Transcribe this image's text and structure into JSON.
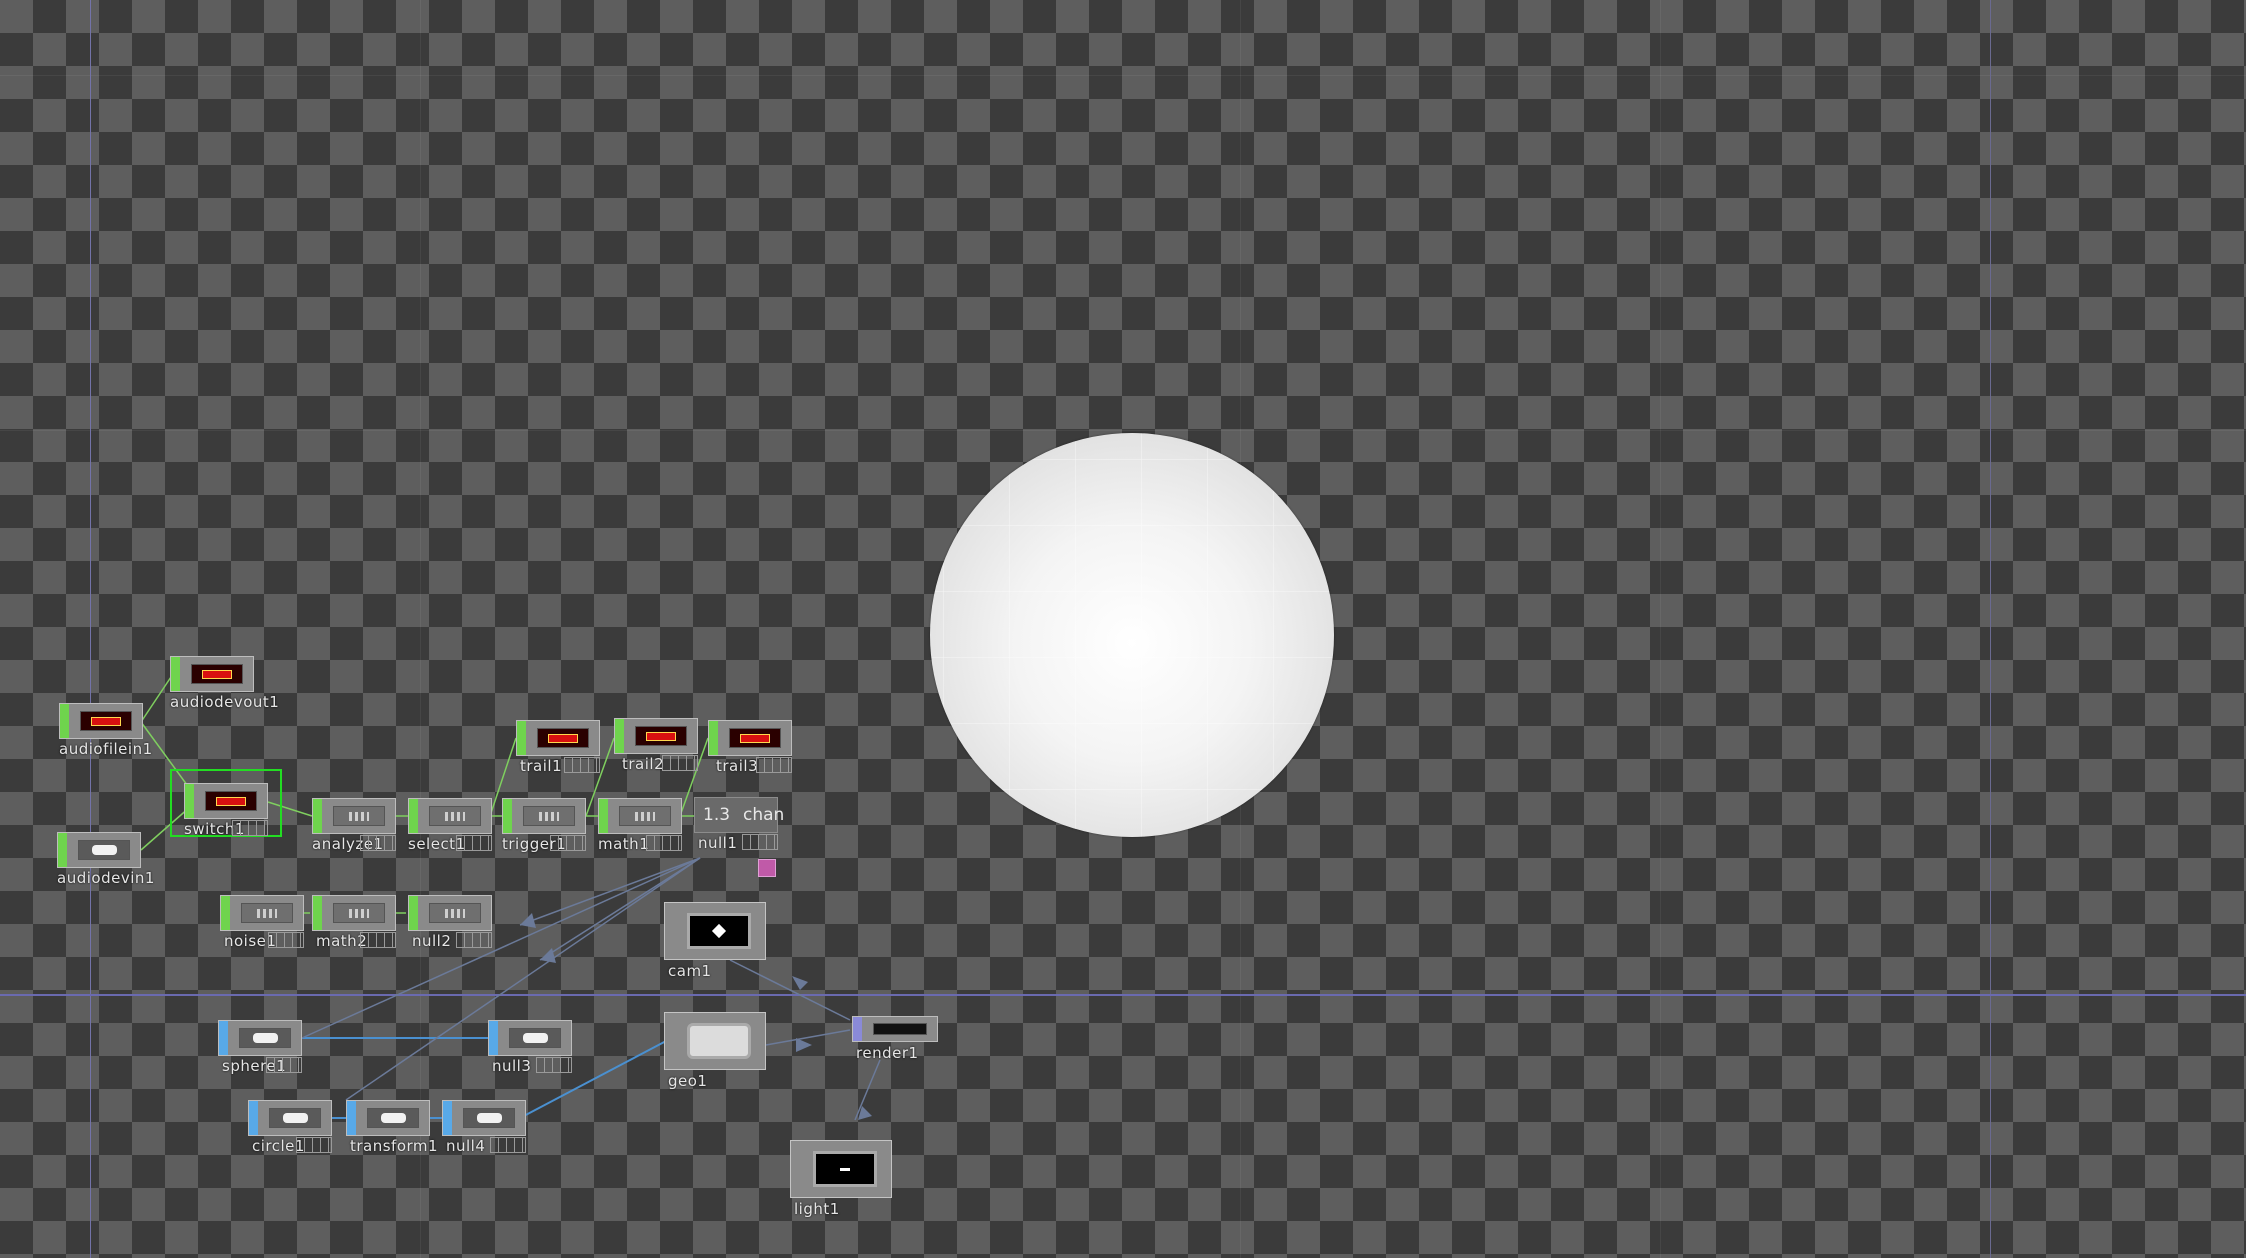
{
  "network": {
    "chop_nodes": [
      {
        "id": "audiodevout1",
        "label": "audiodevout1",
        "thumb": "red"
      },
      {
        "id": "audiofilein1",
        "label": "audiofilein1",
        "thumb": "red"
      },
      {
        "id": "switch1",
        "label": "switch1",
        "thumb": "red",
        "selected": true
      },
      {
        "id": "audiodevin1",
        "label": "audiodevin1",
        "thumb": "white"
      },
      {
        "id": "analyze1",
        "label": "analyze1",
        "thumb": "bars"
      },
      {
        "id": "select1",
        "label": "select1",
        "thumb": "bars"
      },
      {
        "id": "trigger1",
        "label": "trigger1",
        "thumb": "bars"
      },
      {
        "id": "math1",
        "label": "math1",
        "thumb": "bars"
      },
      {
        "id": "trail1",
        "label": "trail1",
        "thumb": "red"
      },
      {
        "id": "trail2",
        "label": "trail2",
        "thumb": "red"
      },
      {
        "id": "trail3",
        "label": "trail3",
        "thumb": "red"
      },
      {
        "id": "noise1",
        "label": "noise1",
        "thumb": "bars"
      },
      {
        "id": "math2",
        "label": "math2",
        "thumb": "bars"
      },
      {
        "id": "null2",
        "label": "null2",
        "thumb": "bars"
      }
    ],
    "null1": {
      "label": "null1",
      "value": "1.3",
      "channel": "chan"
    },
    "sop_nodes": [
      {
        "id": "sphere1",
        "label": "sphere1"
      },
      {
        "id": "null3",
        "label": "null3"
      },
      {
        "id": "circle1",
        "label": "circle1"
      },
      {
        "id": "transform1",
        "label": "transform1"
      },
      {
        "id": "null4",
        "label": "null4"
      }
    ],
    "obj_nodes": [
      {
        "id": "cam1",
        "label": "cam1"
      },
      {
        "id": "geo1",
        "label": "geo1"
      },
      {
        "id": "light1",
        "label": "light1"
      }
    ],
    "top_nodes": [
      {
        "id": "render1",
        "label": "render1"
      }
    ]
  },
  "background_render": {
    "object": "sphere",
    "color": "#f2f2f2"
  },
  "colors": {
    "chop_stripe": "#6fd44d",
    "sop_stripe": "#58a9e8",
    "top_stripe": "#8a8ad8",
    "selection": "#22dd22",
    "wire_chop": "#7fcf5f",
    "wire_sop": "#4a90d0",
    "wire_export": "#6b7a99"
  }
}
